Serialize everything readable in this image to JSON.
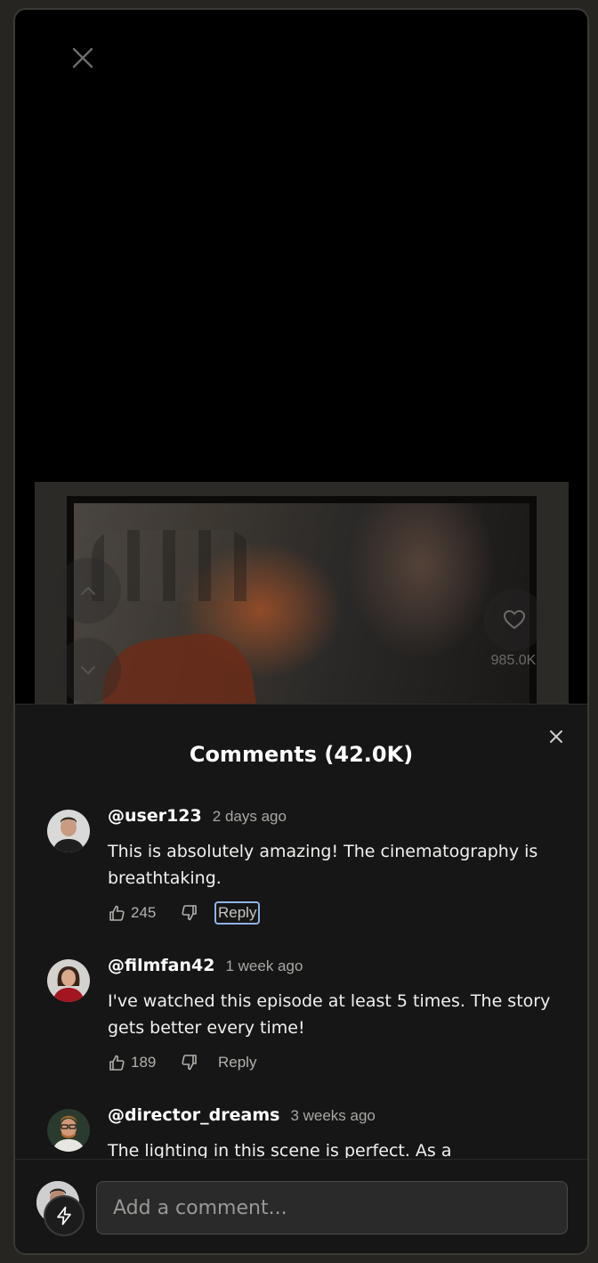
{
  "player": {
    "likes_count": "985.0K"
  },
  "comments_panel": {
    "title": "Comments (42.0K)",
    "comments": [
      {
        "username": "@user123",
        "time": "2 days ago",
        "text": "This is absolutely amazing! The cinematography is breathtaking.",
        "likes": "245",
        "reply_label": "Reply"
      },
      {
        "username": "@filmfan42",
        "time": "1 week ago",
        "text": "I've watched this episode at least 5 times. The story gets better every time!",
        "likes": "189",
        "reply_label": "Reply"
      },
      {
        "username": "@director_dreams",
        "time": "3 weeks ago",
        "text": "The lighting in this scene is perfect. As a"
      }
    ]
  },
  "composer": {
    "placeholder": "Add a comment..."
  },
  "icons": {
    "close": "close-icon",
    "up": "chevron-up-icon",
    "down": "chevron-down-icon",
    "like": "heart-icon",
    "thumbs_up": "thumbs-up-icon",
    "thumbs_down": "thumbs-down-icon",
    "bolt": "bolt-icon"
  }
}
